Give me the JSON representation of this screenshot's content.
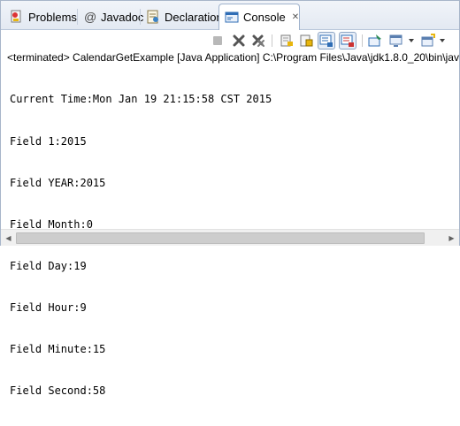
{
  "tabs": [
    {
      "label": "Problems",
      "icon": "problems-icon"
    },
    {
      "label": "Javadoc",
      "icon": "javadoc-at-icon"
    },
    {
      "label": "Declaration",
      "icon": "declaration-icon"
    },
    {
      "label": "Console",
      "icon": "console-icon",
      "active": true,
      "close_glyph": "✕"
    }
  ],
  "javadoc_glyph": "@",
  "toolbar": {
    "icons": [
      "terminate-icon",
      "remove-launch-icon",
      "remove-all-terminated-icon",
      "clear-console-icon",
      "scroll-lock-icon",
      "show-on-stdout-icon",
      "show-on-stderr-icon",
      "pin-console-icon",
      "display-selected-console-icon",
      "open-console-icon"
    ]
  },
  "status_line": "<terminated> CalendarGetExample [Java Application] C:\\Program Files\\Java\\jdk1.8.0_20\\bin\\javaw",
  "console_lines": [
    "Current Time:Mon Jan 19 21:15:58 CST 2015",
    "Field 1:2015",
    "Field YEAR:2015",
    "Field Month:0",
    "Field Day:19",
    "Field Hour:9",
    "Field Minute:15",
    "Field Second:58"
  ],
  "scrollbar": {
    "left_arrow": "◀",
    "right_arrow": "▶"
  },
  "colors": {
    "accent": "#2f6db5",
    "tab_bg": "#e3e9f2",
    "border": "#a7b5c9"
  }
}
